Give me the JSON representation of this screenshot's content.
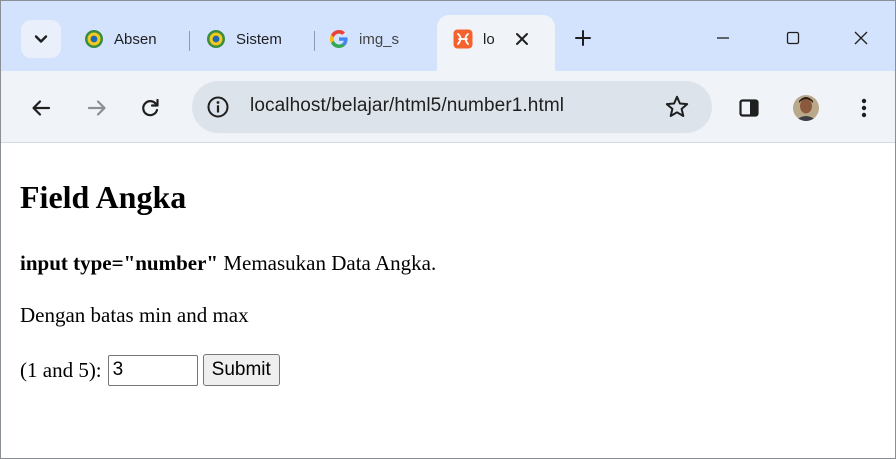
{
  "tabs": [
    {
      "title": "Absen"
    },
    {
      "title": "Sistem"
    },
    {
      "title": "img_s"
    },
    {
      "title": "lo"
    }
  ],
  "address_bar": {
    "url": "localhost/belajar/html5/number1.html"
  },
  "page": {
    "heading": "Field Angka",
    "intro_bold": "input type=\"number\"",
    "intro_text": " Memasukan Data Angka.",
    "note": "Dengan batas min and max",
    "field_label": "(1 and 5):",
    "field_value": "3",
    "submit_label": "Submit"
  },
  "colors": {
    "tabstrip": "#d3e3fd",
    "toolbar": "#f0f4f9",
    "omnibox": "#dde3ea",
    "xampp_orange": "#f4632e"
  },
  "icons": [
    "tab-search-icon",
    "seal-icon",
    "google-icon",
    "xampp-icon",
    "close-icon",
    "plus-icon",
    "minimize-icon",
    "maximize-icon",
    "close-window-icon",
    "back-arrow-icon",
    "forward-arrow-icon",
    "reload-icon",
    "site-info-icon",
    "star-icon",
    "side-panel-icon",
    "profile-avatar",
    "kebab-menu-icon"
  ]
}
